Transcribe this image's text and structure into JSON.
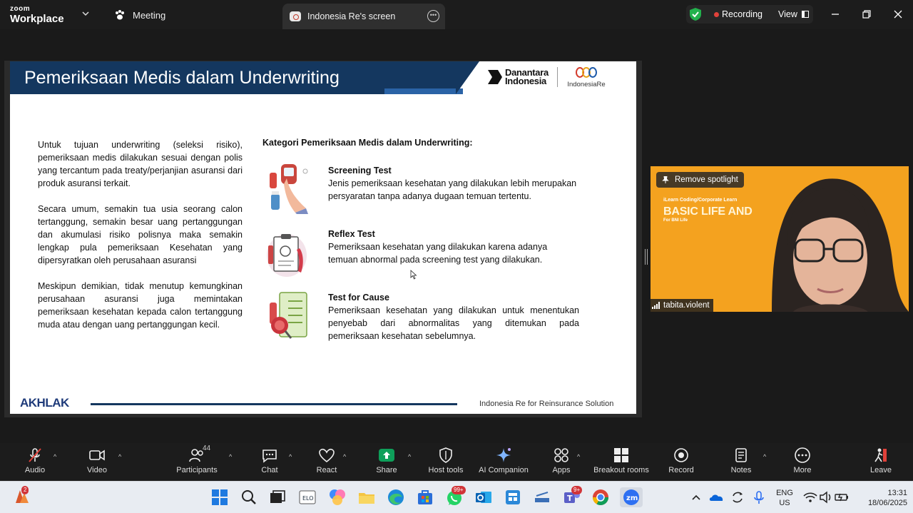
{
  "app": {
    "brand_top": "zoom",
    "brand_bottom": "Workplace"
  },
  "tabs": {
    "meeting": "Meeting",
    "screen": "Indonesia Re's screen"
  },
  "status": {
    "recording": "Recording",
    "view": "View"
  },
  "slide": {
    "title": "Pemeriksaan Medis dalam Underwriting",
    "logo_left_line1": "Danantara",
    "logo_left_line2": "Indonesia",
    "logo_right": "IndonesiaRe",
    "left_paragraphs": [
      "Untuk tujuan underwriting (seleksi risiko), pemeriksaan medis dilakukan sesuai dengan polis yang tercantum pada treaty/perjanjian asuransi dari produk asuransi terkait.",
      "Secara umum, semakin tua usia seorang calon tertanggung, semakin besar uang pertanggungan dan akumulasi risiko polisnya maka semakin lengkap pula pemeriksaan Kesehatan yang dipersyratkan oleh perusahaan asuransi",
      "Meskipun demikian, tidak menutup kemungkinan perusahaan asuransi juga memintakan pemeriksaan kesehatan kepada calon tertanggung muda atau dengan uang pertanggungan kecil."
    ],
    "category_title": "Kategori Pemeriksaan Medis dalam Underwriting:",
    "items": [
      {
        "head": "Screening Test",
        "body": "Jenis pemeriksaan kesehatan yang dilakukan lebih merupakan persyaratan tanpa adanya dugaan temuan tertentu."
      },
      {
        "head": "Reflex Test",
        "body": "Pemeriksaan kesehatan yang dilakukan karena adanya temuan abnormal pada screening test yang dilakukan."
      },
      {
        "head": "Test for Cause",
        "body": "Pemeriksaan kesehatan yang dilakukan untuk menentukan penyebab dari abnormalitas yang ditemukan pada pemeriksaan kesehatan sebelumnya."
      }
    ],
    "footer_logo": "AKHLAK",
    "footer_text": "Indonesia Re for Reinsurance Solution"
  },
  "video": {
    "spotlight_button": "Remove spotlight",
    "participant_name": "tabita.violent",
    "bg_sub": "iLearn Coding/Corporate Learn",
    "bg_title": "BASIC LIFE AND",
    "bg_sub2": "For BNI Life"
  },
  "toolbar": {
    "audio": "Audio",
    "video": "Video",
    "participants": "Participants",
    "participants_count": "44",
    "chat": "Chat",
    "react": "React",
    "share": "Share",
    "host_tools": "Host tools",
    "ai_companion": "AI Companion",
    "apps": "Apps",
    "breakout_rooms": "Breakout rooms",
    "record": "Record",
    "notes": "Notes",
    "more": "More",
    "leave": "Leave"
  },
  "taskbar": {
    "app_badge": "2",
    "whatsapp_badge": "99+",
    "teams_badge": "9+",
    "lang_line1": "ENG",
    "lang_line2": "US",
    "time": "13:31",
    "date": "18/06/2025"
  },
  "colors": {
    "slide_header": "#14375f",
    "recording_dot": "#e0413a",
    "share_green": "#0e9f5a",
    "video_bg": "#f4a21f"
  }
}
